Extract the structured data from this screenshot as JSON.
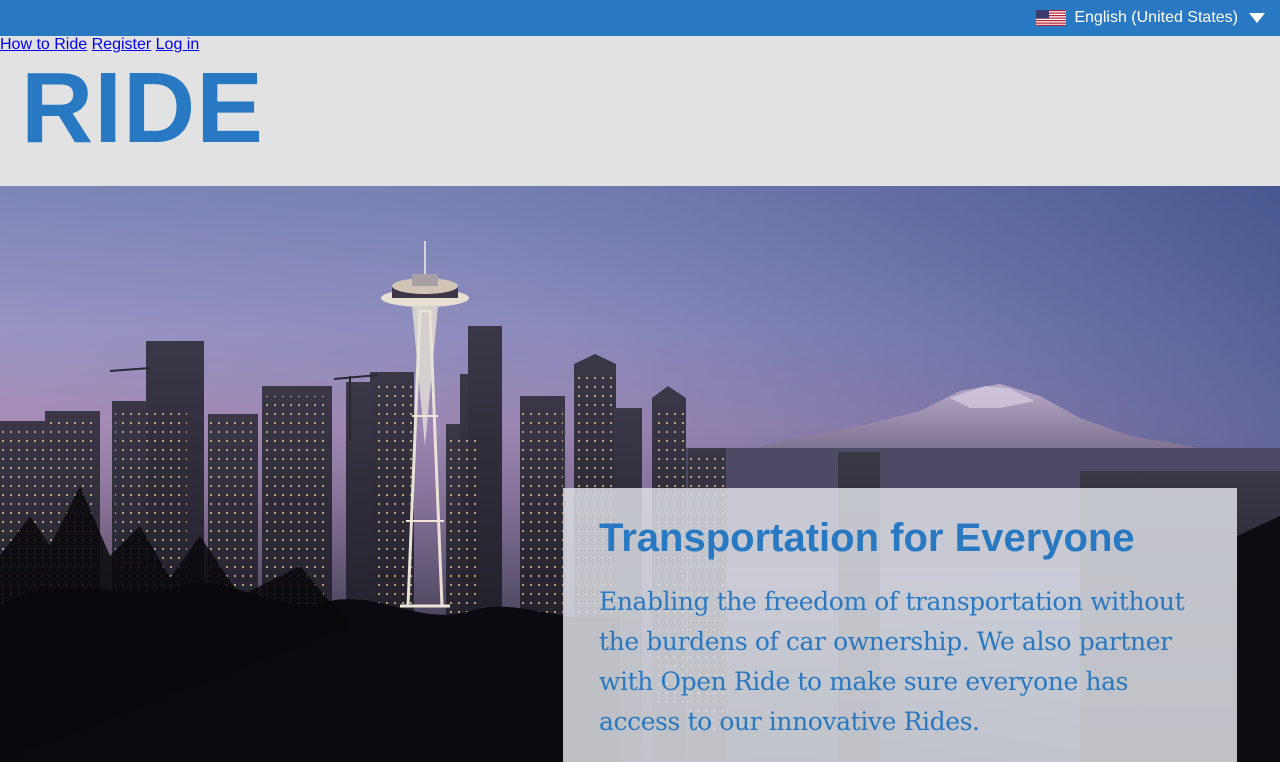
{
  "topbar": {
    "language_label": "English (United States)",
    "flag_icon": "us-flag-icon",
    "caret_icon": "caret-down-icon"
  },
  "header": {
    "logo": "RIDE",
    "nav": {
      "how_to_ride": "How to Ride",
      "register": "Register",
      "login": "Log in"
    }
  },
  "hero": {
    "image_icon": "city-skyline-photo",
    "card": {
      "title": "Transportation for Everyone",
      "body": "Enabling the freedom of transportation without the burdens of car ownership. We also partner with Open Ride to make sure everyone has access to our innovative Rides."
    }
  },
  "colors": {
    "brand_blue": "#2878c2",
    "header_bg": "#e2e2e2",
    "card_bg": "#dcdee4"
  }
}
